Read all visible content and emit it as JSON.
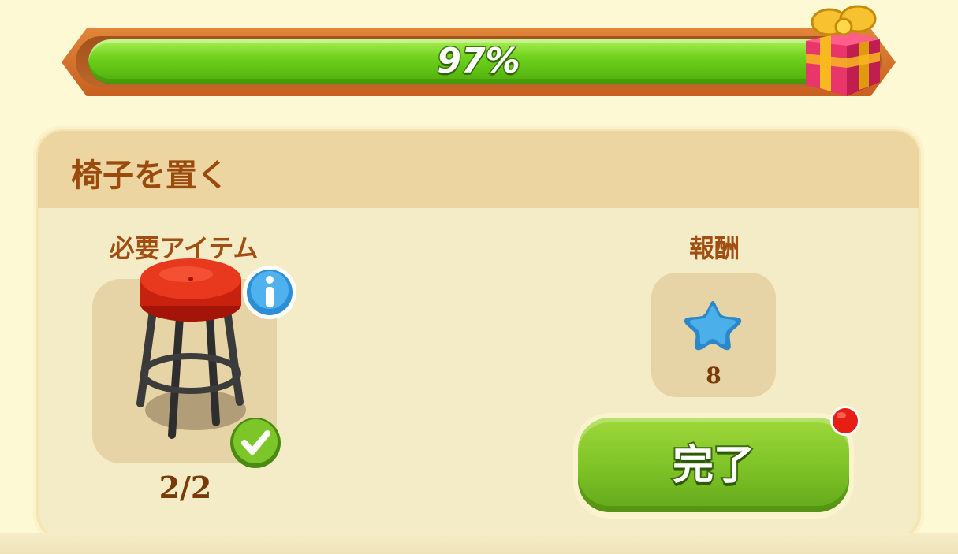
{
  "progress": {
    "percent_label": "97%",
    "value": 0.97
  },
  "task": {
    "title": "椅子を置く",
    "required_label": "必要アイテム",
    "reward_label": "報酬",
    "item_count": "2/2",
    "item_icon": "red-bar-stool",
    "reward_icon": "blue-star",
    "reward_amount": "8",
    "complete_label": "完了"
  },
  "colors": {
    "progress_fill": "#6fd21c",
    "title_text": "#9a4a0c",
    "button_green": "#7cc226",
    "notification": "#e61e14"
  }
}
